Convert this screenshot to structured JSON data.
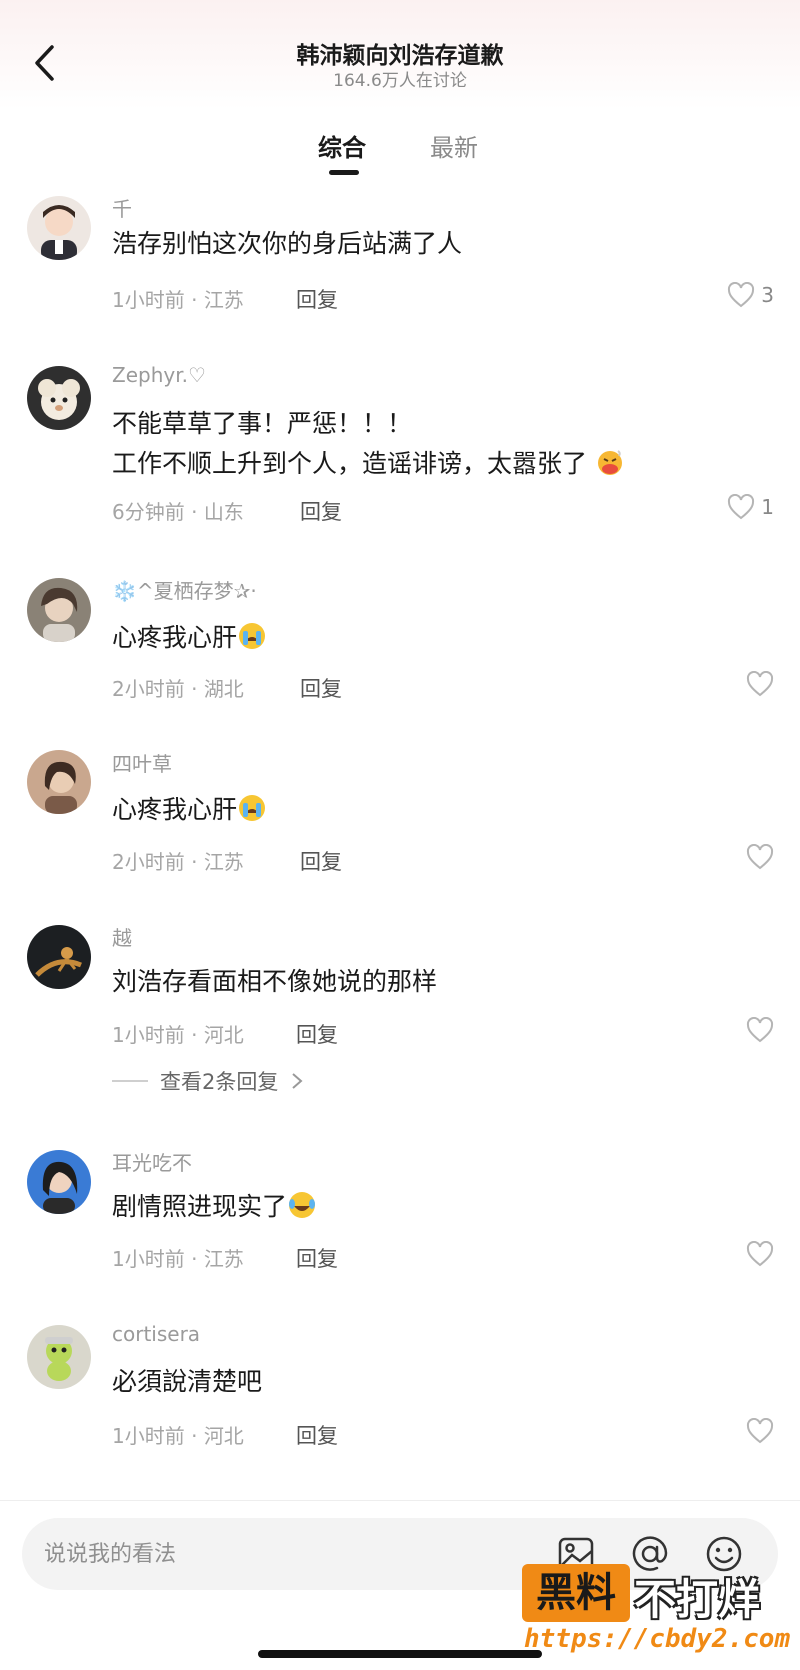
{
  "header": {
    "title": "韩沛颖向刘浩存道歉",
    "subtitle": "164.6万人在讨论",
    "back_icon": "chevron-left-icon"
  },
  "tabs": [
    {
      "label": "综合",
      "active": true
    },
    {
      "label": "最新",
      "active": false
    }
  ],
  "reply_label": "回复",
  "comments": [
    {
      "username": "千",
      "text": "浩存别怕这次你的身后站满了人",
      "time": "1小时前",
      "location": "江苏",
      "likes": "3"
    },
    {
      "username": "Zephyr.♡",
      "text": "不能草草了事！严惩！！！\n工作不顺上升到个人，造谣诽谤，太嚣张了",
      "emoji": "face-with-steam-icon",
      "time": "6分钟前",
      "location": "山东",
      "likes": "1"
    },
    {
      "username": "❄️^夏栖存梦✰·",
      "text": "心疼我心肝",
      "emoji": "crying-face-icon",
      "time": "2小时前",
      "location": "湖北",
      "likes": ""
    },
    {
      "username": "四叶草",
      "text": "心疼我心肝",
      "emoji": "crying-face-icon",
      "time": "2小时前",
      "location": "江苏",
      "likes": ""
    },
    {
      "username": "越",
      "text": "刘浩存看面相不像她说的那样",
      "time": "1小时前",
      "location": "河北",
      "likes": ""
    },
    {
      "username": "耳光吃不",
      "text": "剧情照进现实了",
      "emoji": "tears-of-joy-icon",
      "time": "1小时前",
      "location": "江苏",
      "likes": ""
    },
    {
      "username": "cortisera",
      "text": "必須說清楚吧",
      "time": "1小时前",
      "location": "河北",
      "likes": ""
    }
  ],
  "more_replies_label": "查看2条回复",
  "input": {
    "placeholder": "说说我的看法",
    "value": ""
  },
  "toolbar_icons": [
    "image-icon",
    "at-icon",
    "emoji-icon"
  ],
  "watermark": {
    "box_text": "黑料",
    "text": "不打烊",
    "url": "https://cbdy2.com"
  },
  "colors": {
    "watermark_orange": "#f08a15",
    "text_primary": "#1a1a1a",
    "text_secondary": "#9a9a9a"
  }
}
